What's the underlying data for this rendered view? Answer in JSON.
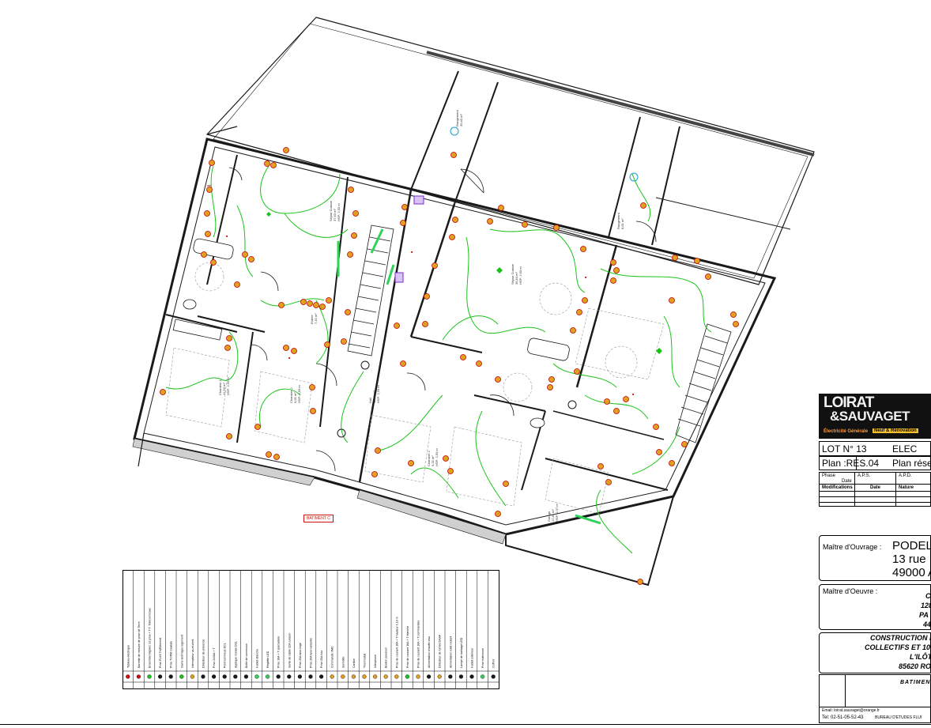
{
  "plan": {
    "building_tag": "BATIMENT C",
    "rooms": [
      {
        "name": "Séjour Cuisine",
        "area": "37,63 m²",
        "height": "HSP: 2,50 m"
      },
      {
        "name": "Séjour Cuisine",
        "area": "35,84 m²",
        "height": "HSP: 2,50 m"
      },
      {
        "name": "Chambre 1",
        "area": "12,50 m²",
        "height": "HSP: 2,50 m"
      },
      {
        "name": "Chambre 2",
        "area": "9,65 m²",
        "height": "HSP: 2,50 m"
      },
      {
        "name": "Chambre 2",
        "area": "9,25 m²",
        "height": "HSP: 2,50 m"
      },
      {
        "name": "Hall",
        "area": "12,50 m²",
        "height": "HSP: 2,50 m"
      },
      {
        "name": "Garage",
        "area": "17,84 m²",
        "height": "HSP: 2,37 m"
      },
      {
        "name": "Rangement",
        "area": "30,40 m²",
        "height": ""
      },
      {
        "name": "Rangement",
        "area": "8,81 m²",
        "height": ""
      },
      {
        "name": "Entrée",
        "area": "7,20 m²",
        "height": ""
      }
    ],
    "symbol_label_bad": "BAE"
  },
  "legend": {
    "items": [
      "Tableau électrique",
      "Barrette de mesure de prise de Terre",
      "Ensemble Nigelec 13 prise + T.T. Télécom/coax",
      "Prise RJ45 Tél/Ethernet",
      "Prise TV/FM coaxiale",
      "Gaine technique logement",
      "Interrupteur va-et-vient",
      "Détecteur de présence",
      "Prise 2x16A + T",
      "Point lumineux DCL",
      "Applique murale DCL",
      "Boîte de connexion",
      "Hublot étanche",
      "Réglette LED",
      "Prise 16A + T spécialisée",
      "Sortie de câble 32A cuisson",
      "Prise 20A lave-linge",
      "Prise 20A lave-vaisselle",
      "Prise 20A four",
      "Commande VMC",
      "Sonnette",
      "Carillon",
      "Thermostat",
      "Interphone",
      "Bouton poussoir",
      "Prise de courant 16A + T hauteur 1,10 m",
      "Prise de courant 16A + T étanche",
      "Prise de courant 16A + T commandée",
      "Alimentation chauffe-eau",
      "Détecteur de fumée DAAF",
      "Alimentation volet roulant",
      "Lampe de balisage LED",
      "Hublot extérieur",
      "Prise extérieure",
      "Coffret"
    ]
  },
  "title_block": {
    "company_line1": "LOIRAT",
    "company_line2": "&SAUVAGET",
    "tagline": "Électricité Générale",
    "tagline2": "Neuf & Rénovation",
    "lot": "LOT N° 13",
    "lot_title": "ELEC",
    "plan_label": "Plan :RES.04",
    "plan_title": "Plan rése",
    "phase_label": "Phase",
    "phase_cols": [
      "A.P.S.",
      "A.P.D."
    ],
    "date_label": "Date",
    "modifications_label": "Modifications",
    "mod_cols": [
      "Date",
      "Nature"
    ],
    "moa_label": "Maître d'Ouvrage :",
    "moa_name": "PODEL",
    "moa_addr1": "13 rue E",
    "moa_addr2": "49000 A",
    "moe_label": "Maître d'Oeuvre :",
    "moe_lines": [
      "C",
      "128 r",
      "PA de",
      "441"
    ],
    "project_lines": [
      "CONSTRUCTION D",
      "COLLECTIFS ET 10 M",
      "L'ILÔT",
      "85620 RO"
    ],
    "building": "BATIMEN",
    "email": "Email: loirat.sauvaget@orange.fr",
    "tel": "Tel: 02-51-05-52-43",
    "bet": "BUREAU D'ETUDES FLUI"
  },
  "colors": {
    "walls": "#1a1a1a",
    "wiring": "#19c419",
    "symbol_fill": "#e0a020",
    "symbol_stroke": "#c00000",
    "accent_green": "#2fd35a",
    "annotation_red": "#d01010",
    "hatch": "#777777"
  }
}
